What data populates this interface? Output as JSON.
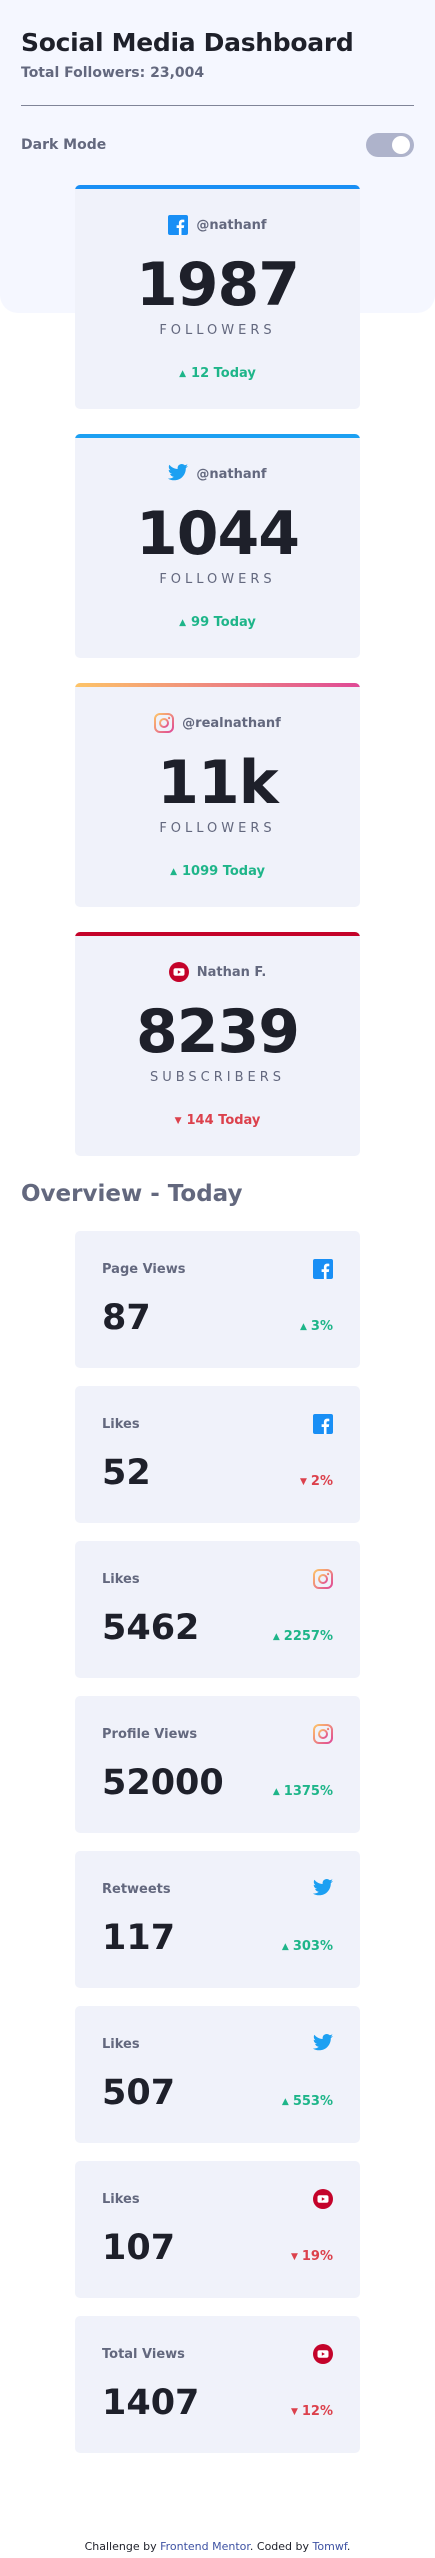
{
  "header": {
    "title": "Social Media Dashboard",
    "subtitle": "Total Followers: 23,004",
    "mode_label": "Dark Mode"
  },
  "colors": {
    "facebook": "#198ff5",
    "twitter": "#1ca0f2",
    "instagram_start": "#fdc468",
    "instagram_end": "#df4996",
    "youtube": "#c4032a",
    "up": "#1eb589",
    "down": "#dc414c"
  },
  "follower_cards": [
    {
      "platform": "facebook",
      "icon": "facebook-icon",
      "handle": "@nathanf",
      "count": "1987",
      "unit": "FOLLOWERS",
      "delta": "12 Today",
      "trend": "up"
    },
    {
      "platform": "twitter",
      "icon": "twitter-icon",
      "handle": "@nathanf",
      "count": "1044",
      "unit": "FOLLOWERS",
      "delta": "99 Today",
      "trend": "up"
    },
    {
      "platform": "instagram",
      "icon": "instagram-icon",
      "handle": "@realnathanf",
      "count": "11k",
      "unit": "FOLLOWERS",
      "delta": "1099 Today",
      "trend": "up"
    },
    {
      "platform": "youtube",
      "icon": "youtube-icon",
      "handle": "Nathan F.",
      "count": "8239",
      "unit": "SUBSCRIBERS",
      "delta": "144 Today",
      "trend": "down"
    }
  ],
  "overview": {
    "title": "Overview - Today",
    "cards": [
      {
        "metric": "Page Views",
        "icon": "facebook-icon",
        "value": "87",
        "pct": "3%",
        "trend": "up"
      },
      {
        "metric": "Likes",
        "icon": "facebook-icon",
        "value": "52",
        "pct": "2%",
        "trend": "down"
      },
      {
        "metric": "Likes",
        "icon": "instagram-icon",
        "value": "5462",
        "pct": "2257%",
        "trend": "up"
      },
      {
        "metric": "Profile Views",
        "icon": "instagram-icon",
        "value": "52000",
        "pct": "1375%",
        "trend": "up"
      },
      {
        "metric": "Retweets",
        "icon": "twitter-icon",
        "value": "117",
        "pct": "303%",
        "trend": "up"
      },
      {
        "metric": "Likes",
        "icon": "twitter-icon",
        "value": "507",
        "pct": "553%",
        "trend": "up"
      },
      {
        "metric": "Likes",
        "icon": "youtube-icon",
        "value": "107",
        "pct": "19%",
        "trend": "down"
      },
      {
        "metric": "Total Views",
        "icon": "youtube-icon",
        "value": "1407",
        "pct": "12%",
        "trend": "down"
      }
    ]
  },
  "footer": {
    "prefix": "Challenge by ",
    "link1": "Frontend Mentor",
    "middle": ". Coded by ",
    "link2": "Tomwf",
    "suffix": "."
  }
}
